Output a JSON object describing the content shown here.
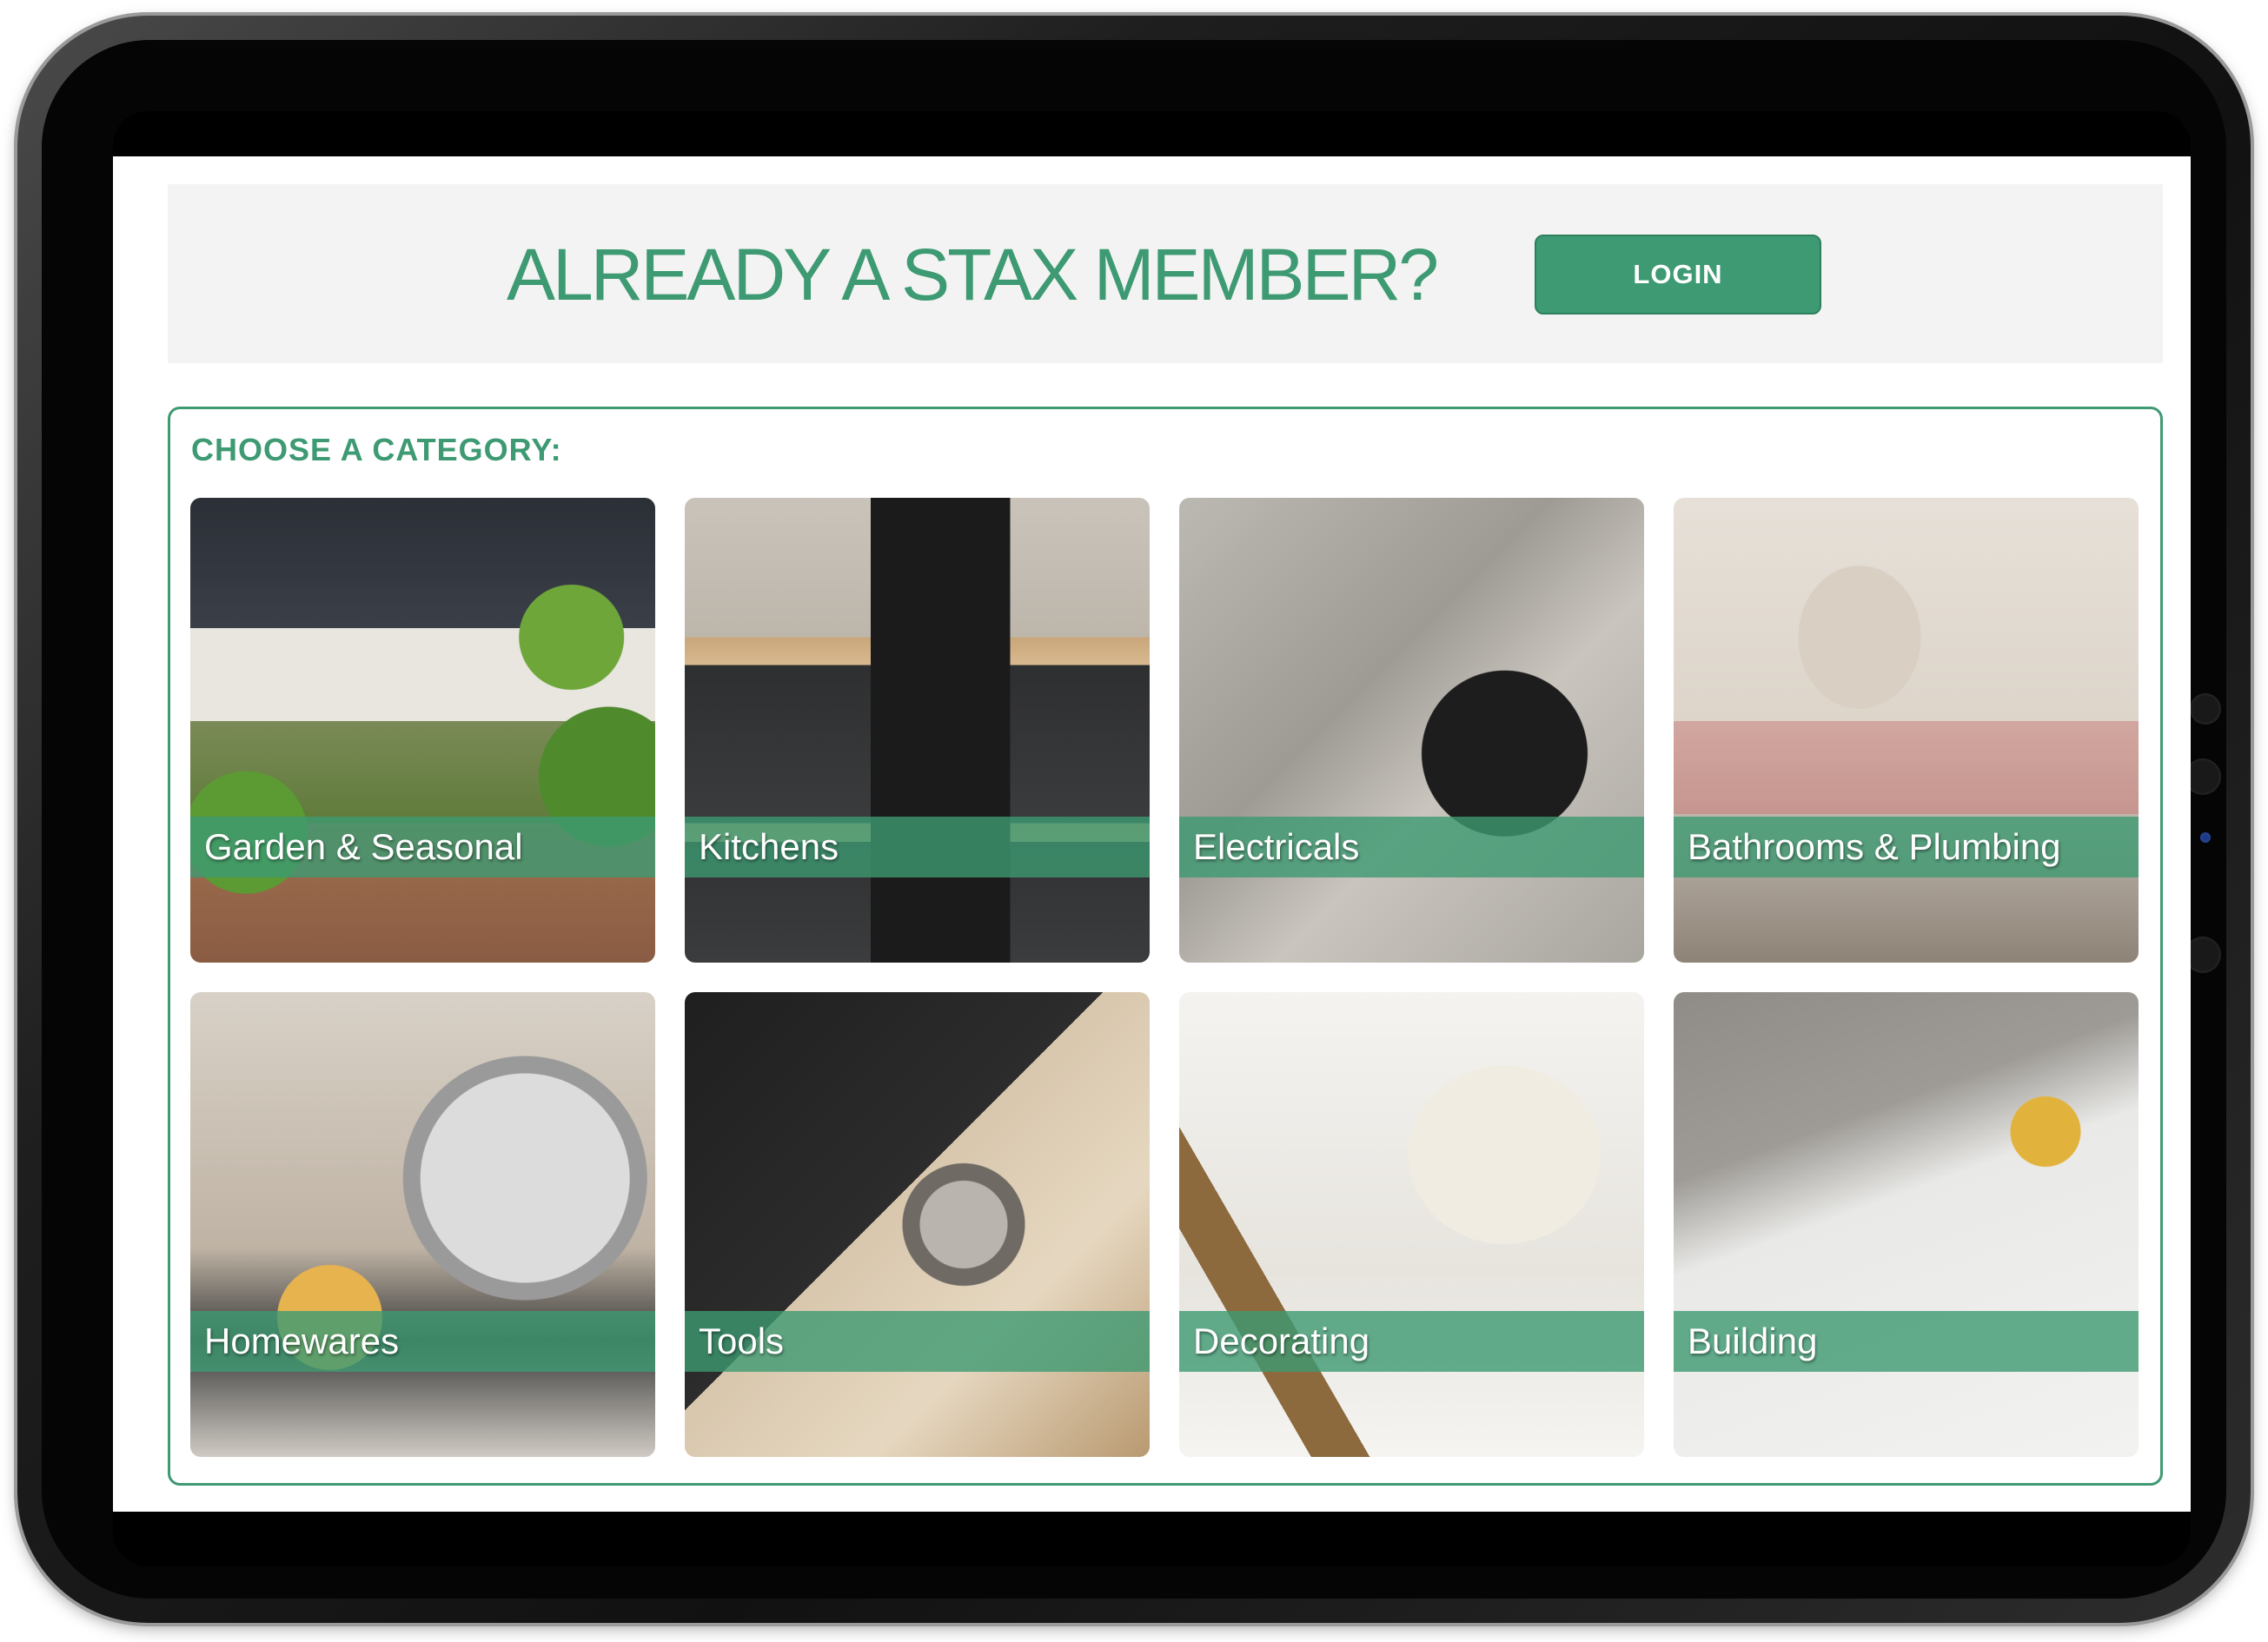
{
  "banner": {
    "title": "ALREADY A STAX MEMBER?",
    "login_label": "LOGIN"
  },
  "categories": {
    "heading": "CHOOSE A CATEGORY:",
    "items": [
      {
        "label": "Garden & Seasonal"
      },
      {
        "label": "Kitchens"
      },
      {
        "label": "Electricals"
      },
      {
        "label": "Bathrooms & Plumbing"
      },
      {
        "label": "Homewares"
      },
      {
        "label": "Tools"
      },
      {
        "label": "Decorating"
      },
      {
        "label": "Building"
      }
    ]
  },
  "theme": {
    "accent": "#3d9a72",
    "banner_bg": "#f3f3f3",
    "label_bar": "#3d9a72"
  }
}
